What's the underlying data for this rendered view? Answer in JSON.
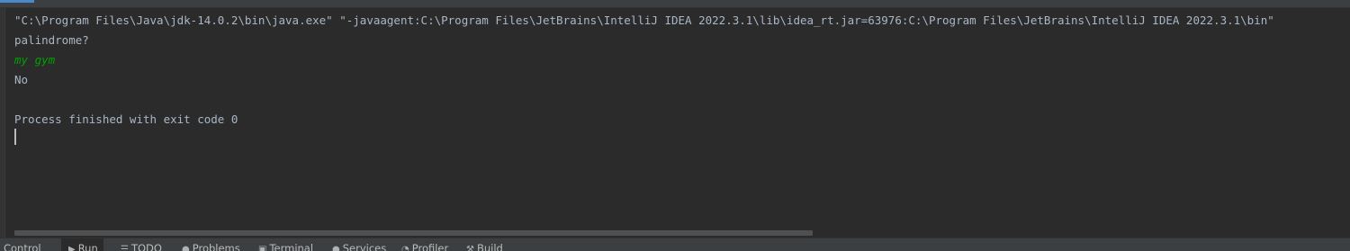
{
  "console": {
    "command_line": "\"C:\\Program Files\\Java\\jdk-14.0.2\\bin\\java.exe\" \"-javaagent:C:\\Program Files\\JetBrains\\IntelliJ IDEA 2022.3.1\\lib\\idea_rt.jar=63976:C:\\Program Files\\JetBrains\\IntelliJ IDEA 2022.3.1\\bin\"",
    "prompt": "palindrome?",
    "user_input": "my gym",
    "output": "No",
    "exit_message": "Process finished with exit code 0"
  },
  "toolwindow_tabs": [
    {
      "label": "on Control",
      "icon": "",
      "active": false
    },
    {
      "label": "Run",
      "icon": "run-icon",
      "active": true
    },
    {
      "label": "TODO",
      "icon": "todo-icon",
      "active": false
    },
    {
      "label": "Problems",
      "icon": "problems-icon",
      "active": false
    },
    {
      "label": "Terminal",
      "icon": "terminal-icon",
      "active": false
    },
    {
      "label": "Services",
      "icon": "services-icon",
      "active": false
    },
    {
      "label": "Profiler",
      "icon": "profiler-icon",
      "active": false
    },
    {
      "label": "Build",
      "icon": "build-icon",
      "active": false
    }
  ],
  "colors": {
    "background": "#2b2b2b",
    "text": "#a9b7c6",
    "user_input": "#00a000",
    "toolbar": "#3c3f41"
  }
}
